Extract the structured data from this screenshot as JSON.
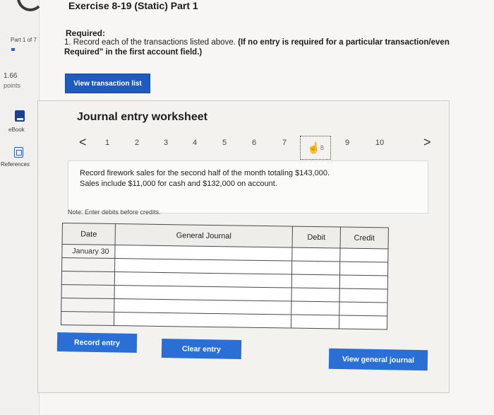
{
  "sidebar": {
    "part_label": "Part 1 of 7",
    "points_value": "1.66",
    "points_label": "points",
    "ebook_label": "eBook",
    "references_label": "References"
  },
  "header": {
    "title": "Exercise 8-19 (Static) Part 1"
  },
  "instructions": {
    "required_label": "Required:",
    "line1_plain": "1. Record each of the transactions listed above. ",
    "line1_bold": "(If no entry is required for a particular transaction/even",
    "line2_bold": "Required\" in the first account field.)",
    "view_transaction_list": "View transaction list"
  },
  "worksheet": {
    "title": "Journal entry worksheet",
    "prev_arrow": "<",
    "next_arrow": ">",
    "pages": [
      "1",
      "2",
      "3",
      "4",
      "5",
      "6",
      "7",
      "8",
      "9",
      "10"
    ],
    "current_page": "8",
    "description_line1": "Record firework sales for the second half of the month totaling $143,000.",
    "description_line2": "Sales include $11,000 for cash and $132,000 on account.",
    "note": "Note: Enter debits before credits.",
    "table": {
      "headers": [
        "Date",
        "General Journal",
        "Debit",
        "Credit"
      ],
      "date_value": "January 30"
    },
    "buttons": {
      "record_entry": "Record entry",
      "clear_entry": "Clear entry",
      "view_general_journal": "View general journal"
    }
  }
}
